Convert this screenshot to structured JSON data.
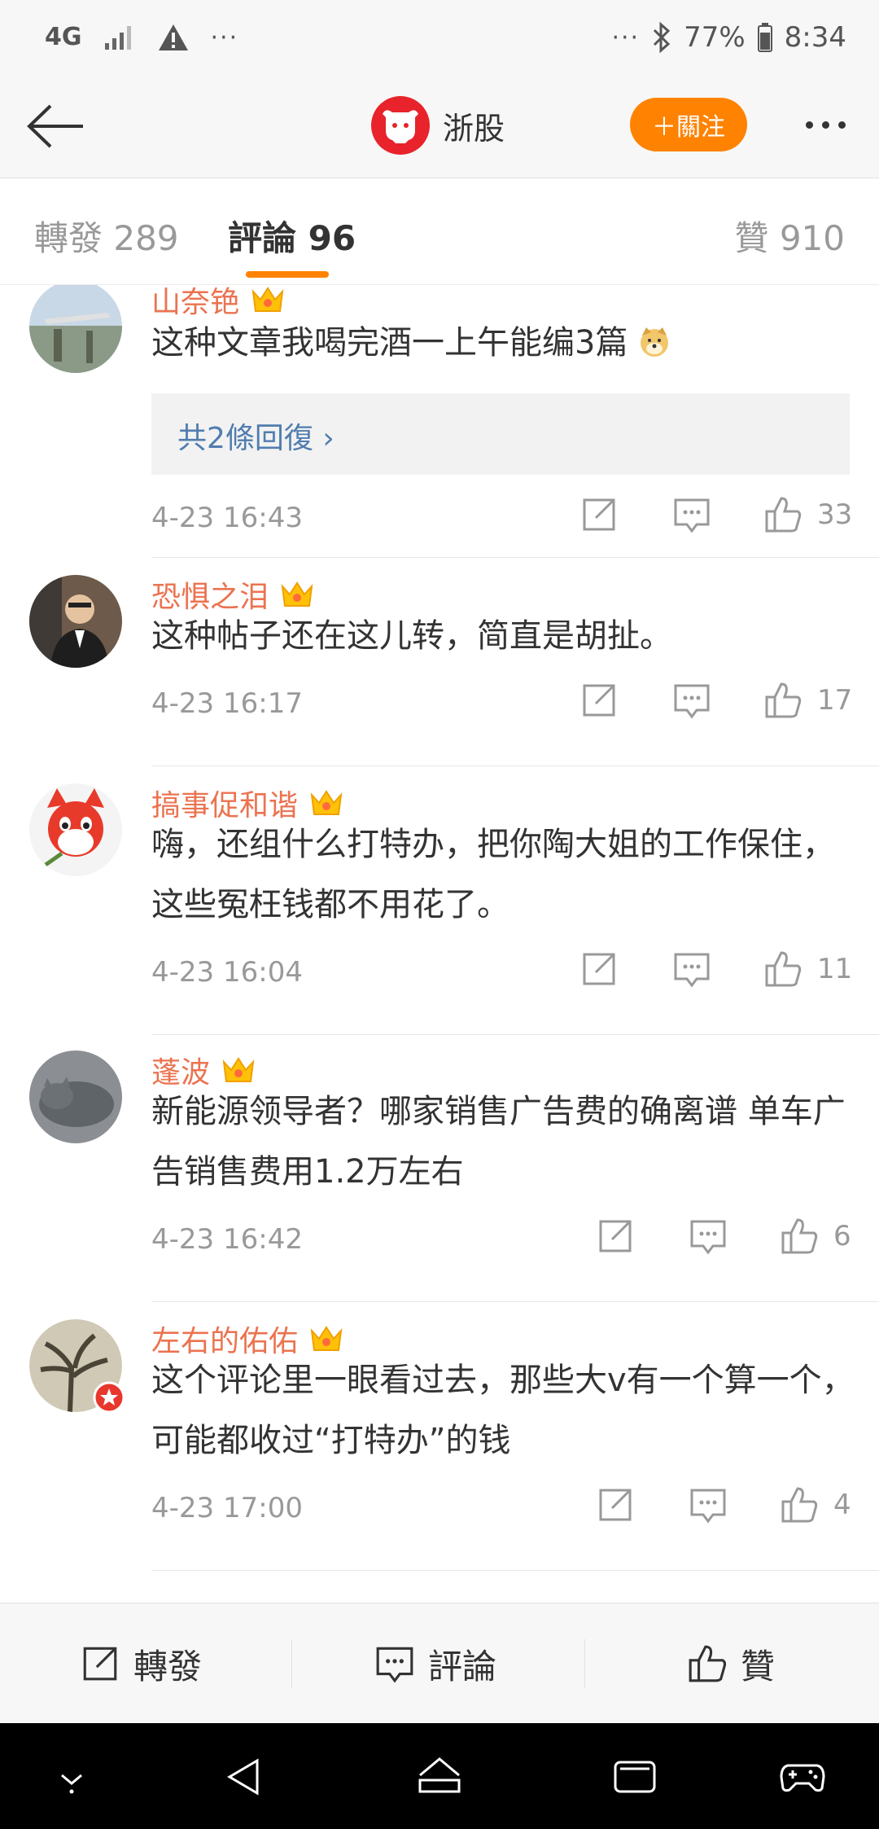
{
  "status_bar": {
    "network": "4G",
    "left_more": "···",
    "right_more": "···",
    "battery": "77%",
    "time": "8:34"
  },
  "header": {
    "account_name": "浙股",
    "follow_label": "＋關注"
  },
  "tabs": [
    {
      "label": "轉發 289"
    },
    {
      "label": "評論 96"
    },
    {
      "label": "贊 910"
    }
  ],
  "comments": [
    {
      "user": "山奈铯",
      "text": "这种文章我喝完酒一上午能编3篇",
      "replies_label": "共2條回復 ›",
      "time": "4-23 16:43",
      "likes": "33"
    },
    {
      "user": "恐惧之泪",
      "text": "这种帖子还在这儿转，简直是胡扯。",
      "time": "4-23 16:17",
      "likes": "17"
    },
    {
      "user": "搞事促和谐",
      "text": "嗨，还组什么打特办，把你陶大姐的工作保住，这些冤枉钱都不用花了。",
      "time": "4-23 16:04",
      "likes": "11"
    },
    {
      "user": "蓬波",
      "text": "新能源领导者？哪家销售广告费的确离谱 单车广告销售费用1.2万左右",
      "time": "4-23 16:42",
      "likes": "6"
    },
    {
      "user": "左右的佑佑",
      "text": "这个评论里一眼看过去，那些大v有一个算一个，可能都收过“打特办”的钱",
      "time": "4-23 17:00",
      "likes": "4"
    }
  ],
  "bottom_bar": {
    "repost_label": "轉發",
    "comment_label": "評論",
    "like_label": "贊"
  },
  "colors": {
    "accent": "#ff8200",
    "username": "#eb7350",
    "reply_link": "#507daf"
  }
}
